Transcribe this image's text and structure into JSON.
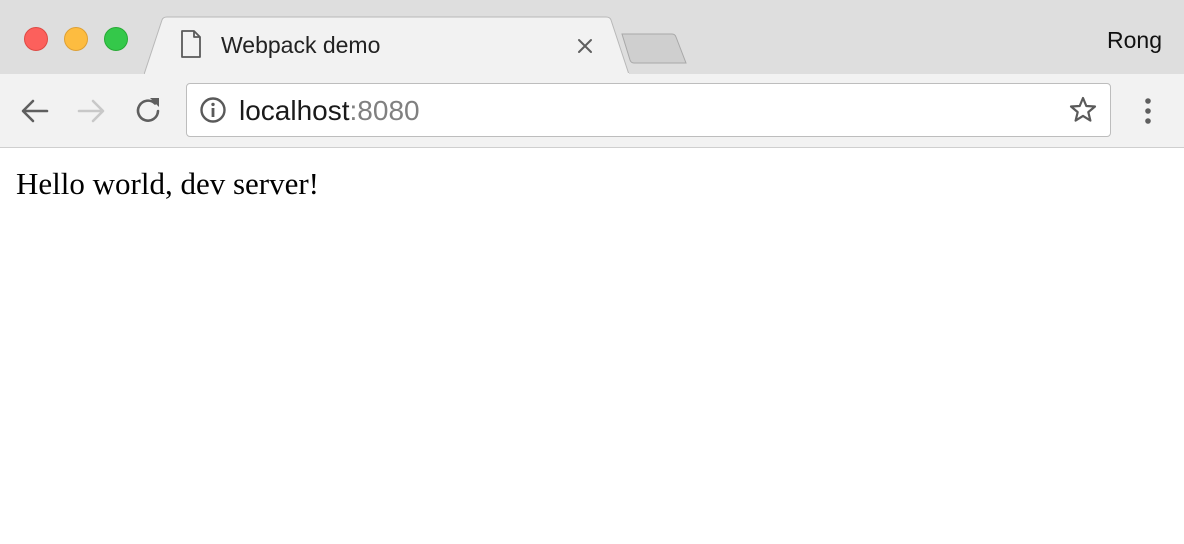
{
  "window": {
    "profile_name": "Rong"
  },
  "tabs": [
    {
      "title": "Webpack demo",
      "icon": "document-icon",
      "active": true
    }
  ],
  "toolbar": {
    "back_icon": "back-arrow-icon",
    "forward_icon": "forward-arrow-icon",
    "forward_enabled": false,
    "reload_icon": "reload-icon",
    "menu_icon": "vertical-dots-icon"
  },
  "omnibox": {
    "security_icon": "info-icon",
    "host": "localhost",
    "port": ":8080",
    "bookmark_icon": "star-outline-icon"
  },
  "page": {
    "body_text": "Hello world, dev server!"
  },
  "colors": {
    "traffic_close": "#fc605c",
    "traffic_minimize": "#fdbc40",
    "traffic_zoom": "#34c84a",
    "tabstrip_bg": "#dedede",
    "active_tab_bg": "#f2f2f2",
    "url_port": "#808080"
  }
}
